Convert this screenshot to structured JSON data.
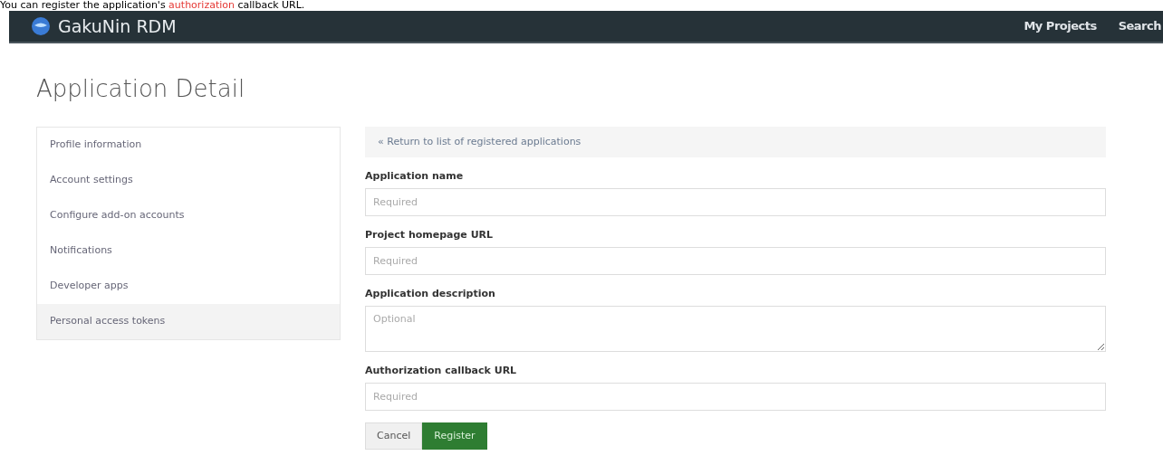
{
  "caption": [
    {
      "text": "You can register the application's ",
      "highlight": false
    },
    {
      "text": "authorization",
      "highlight": true
    },
    {
      "text": " callback URL.",
      "highlight": false
    }
  ],
  "navbar": {
    "brand": "GakuNin RDM",
    "links": [
      "My Projects",
      "Search"
    ]
  },
  "page_title": "Application Detail",
  "sidebar": {
    "items": [
      {
        "label": "Profile information",
        "selected": false
      },
      {
        "label": "Account settings",
        "selected": false
      },
      {
        "label": "Configure add-on accounts",
        "selected": false
      },
      {
        "label": "Notifications",
        "selected": false
      },
      {
        "label": "Developer apps",
        "selected": false
      },
      {
        "label": "Personal access tokens",
        "selected": true
      }
    ]
  },
  "back_link": "« Return to list of registered applications",
  "fields": [
    {
      "kind": "input",
      "label": "Application name",
      "placeholder": "Required"
    },
    {
      "kind": "input",
      "label": "Project homepage URL",
      "placeholder": "Required"
    },
    {
      "kind": "textarea",
      "label": "Application description",
      "placeholder": "Optional"
    },
    {
      "kind": "input",
      "label": "Authorization callback URL",
      "placeholder": "Required"
    }
  ],
  "buttons": [
    {
      "kind": "cancel",
      "label": "Cancel"
    },
    {
      "kind": "primary",
      "label": "Register"
    }
  ]
}
